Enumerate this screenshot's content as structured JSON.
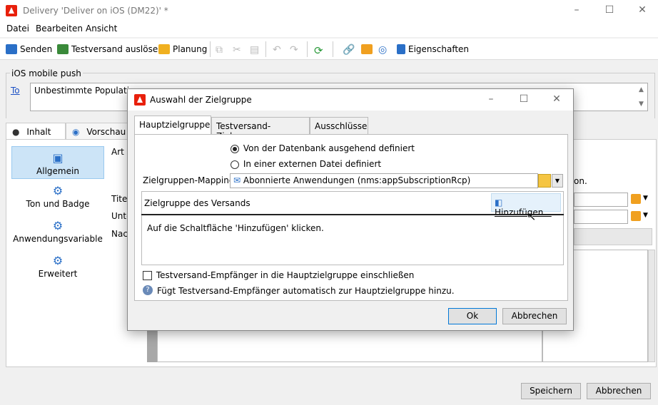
{
  "window": {
    "title": "Delivery 'Deliver on iOS (DM22)' *",
    "controls": [
      "–",
      "☐",
      "✕"
    ]
  },
  "menu": [
    "Datei",
    "Bearbeiten",
    "Ansicht"
  ],
  "toolbar": {
    "send": "Senden",
    "proof": "Testversand auslösen",
    "schedule": "Planung",
    "properties": "Eigenschaften"
  },
  "form": {
    "group_legend": "iOS mobile push",
    "to_link": "To",
    "to_value": "Unbestimmte Population",
    "tabs": [
      "Inhalt",
      "Vorschau"
    ],
    "nav": [
      "Allgemein",
      "Ton und Badge",
      "Anwendungsvariable",
      "Erweitert"
    ],
    "labels": [
      "Art d",
      "Titel",
      "Unte",
      "Nach"
    ],
    "hint_tail": "on."
  },
  "footer": {
    "save": "Speichern",
    "cancel": "Abbrechen"
  },
  "dialog": {
    "title": "Auswahl der Zielgruppe",
    "tabs": [
      "Hauptzielgruppe",
      "Testversand-Zielgruppe",
      "Ausschlüsse"
    ],
    "radio_db": "Von der Datenbank ausgehend definiert",
    "radio_file": "In einer externen Datei definiert",
    "mapping_label": "Zielgruppen-Mapping:",
    "mapping_value": "Abonnierte Anwendungen (nms:appSubscriptionRcp)",
    "target_label": "Zielgruppe des Versands",
    "add_button": "Hinzufügen...",
    "empty_text": "Auf die Schaltfläche 'Hinzufügen' klicken.",
    "checkbox_label": "Testversand-Empfänger in die Hauptzielgruppe einschließen",
    "help_text": "Fügt Testversand-Empfänger automatisch zur Hauptzielgruppe hinzu.",
    "ok": "Ok",
    "cancel": "Abbrechen"
  }
}
